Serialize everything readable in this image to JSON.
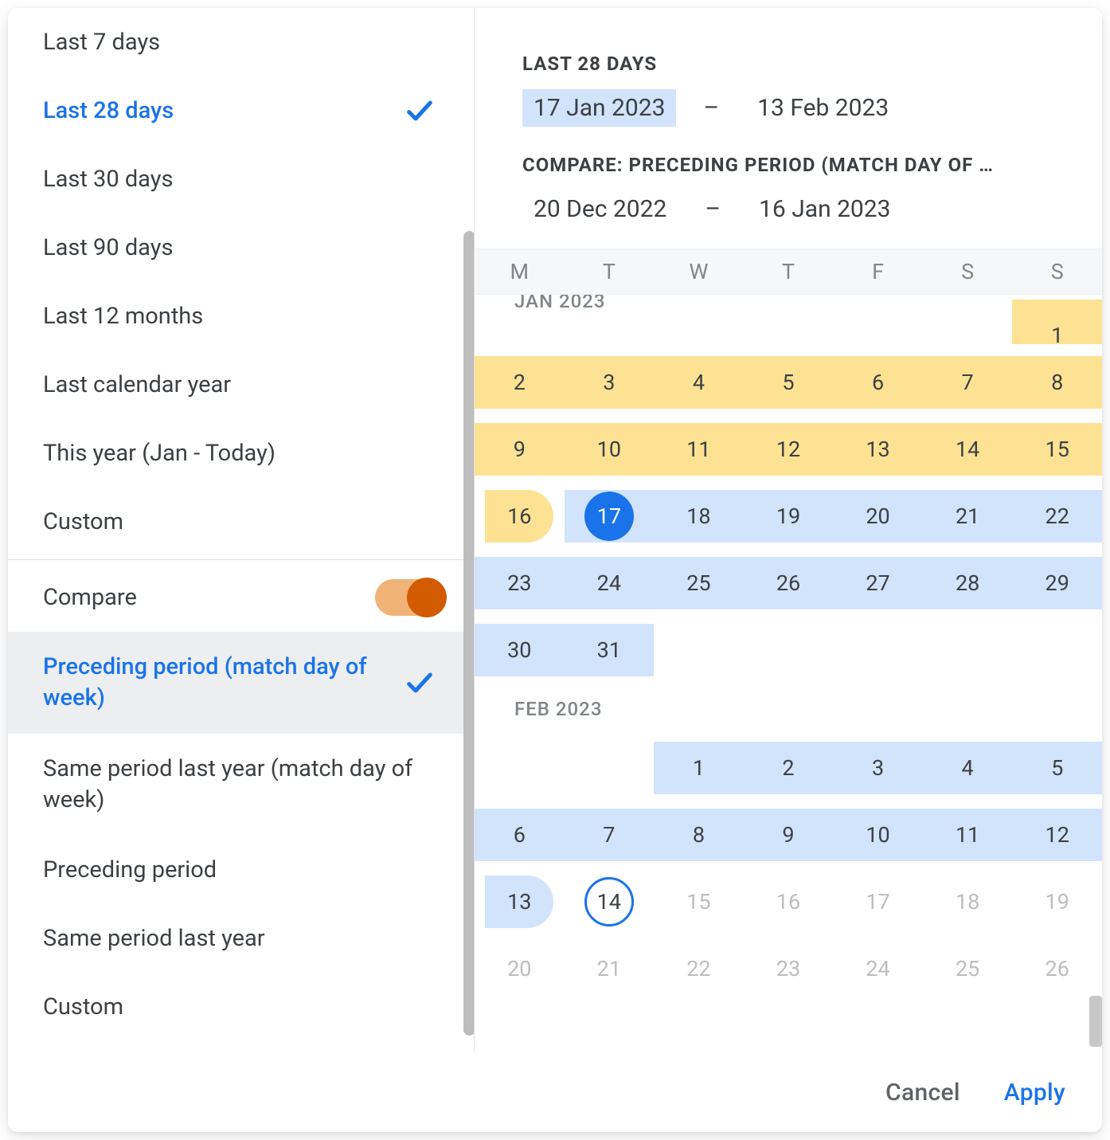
{
  "presets_top": [
    {
      "id": "last7",
      "label": "Last 7 days",
      "selected": false
    },
    {
      "id": "last28",
      "label": "Last 28 days",
      "selected": true
    },
    {
      "id": "last30",
      "label": "Last 30 days",
      "selected": false
    },
    {
      "id": "last90",
      "label": "Last 90 days",
      "selected": false
    },
    {
      "id": "last12m",
      "label": "Last 12 months",
      "selected": false
    },
    {
      "id": "lastcalyear",
      "label": "Last calendar year",
      "selected": false
    },
    {
      "id": "thisyear",
      "label": "This year (Jan - Today)",
      "selected": false
    },
    {
      "id": "custom",
      "label": "Custom",
      "selected": false
    }
  ],
  "compare": {
    "label": "Compare",
    "on": true
  },
  "presets_compare": [
    {
      "id": "pp_dow",
      "label": "Preceding period (match day of week)",
      "selected": true,
      "multiline": true
    },
    {
      "id": "sply_dow",
      "label": "Same period last year (match day of week)",
      "selected": false,
      "multiline": true
    },
    {
      "id": "pp",
      "label": "Preceding period",
      "selected": false,
      "multiline": false
    },
    {
      "id": "sply",
      "label": "Same period last year",
      "selected": false,
      "multiline": false
    },
    {
      "id": "ccustom",
      "label": "Custom",
      "selected": false,
      "multiline": false
    }
  ],
  "header": {
    "cap1": "LAST 28 DAYS",
    "date1_from": "17 Jan 2023",
    "date1_sep": "–",
    "date1_to": "13 Feb 2023",
    "cap2": "COMPARE: PRECEDING PERIOD (MATCH DAY OF …",
    "date2_from": "20 Dec 2022",
    "date2_sep": "–",
    "date2_to": "16 Jan 2023"
  },
  "weekdays": [
    "M",
    "T",
    "W",
    "T",
    "F",
    "S",
    "S"
  ],
  "months": {
    "jan": {
      "label": "JAN 2023"
    },
    "feb": {
      "label": "FEB 2023"
    }
  },
  "calendar": {
    "jan": {
      "w0": {
        "d7": "1"
      },
      "w1": {
        "d1": "2",
        "d2": "3",
        "d3": "4",
        "d4": "5",
        "d5": "6",
        "d6": "7",
        "d7": "8"
      },
      "w2": {
        "d1": "9",
        "d2": "10",
        "d3": "11",
        "d4": "12",
        "d5": "13",
        "d6": "14",
        "d7": "15"
      },
      "w3": {
        "d1": "16",
        "d2": "17",
        "d3": "18",
        "d4": "19",
        "d5": "20",
        "d6": "21",
        "d7": "22"
      },
      "w4": {
        "d1": "23",
        "d2": "24",
        "d3": "25",
        "d4": "26",
        "d5": "27",
        "d6": "28",
        "d7": "29"
      },
      "w5": {
        "d1": "30",
        "d2": "31"
      }
    },
    "feb": {
      "w1": {
        "d1": "",
        "d2": "",
        "d3": "1",
        "d4": "2",
        "d5": "3",
        "d6": "4",
        "d7": "5"
      },
      "w2": {
        "d1": "6",
        "d2": "7",
        "d3": "8",
        "d4": "9",
        "d5": "10",
        "d6": "11",
        "d7": "12"
      },
      "w3": {
        "d1": "13",
        "d2": "14",
        "d3": "15",
        "d4": "16",
        "d5": "17",
        "d6": "18",
        "d7": "19"
      },
      "w4": {
        "d1": "20",
        "d2": "21",
        "d3": "22",
        "d4": "23",
        "d5": "24",
        "d6": "25",
        "d7": "26"
      }
    }
  },
  "footer": {
    "cancel": "Cancel",
    "apply": "Apply"
  },
  "colors": {
    "blue": "#1a73e8",
    "rangeBlue": "#d2e3fc",
    "rangeYellow": "#fde293",
    "switch": "#d25a00"
  }
}
